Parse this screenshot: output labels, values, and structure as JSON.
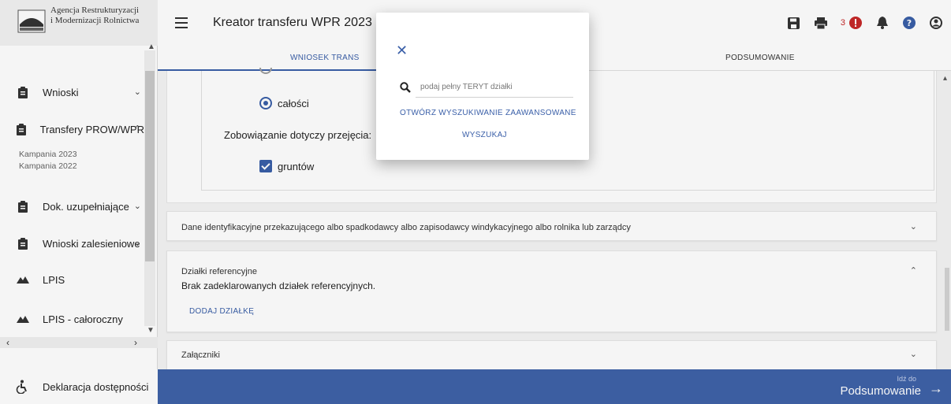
{
  "brand": {
    "line1": "Agencja Restrukturyzacji",
    "line2": "i Modernizacji Rolnictwa"
  },
  "sidebar": {
    "items": [
      {
        "label": "Wnioski",
        "icon": "clipboard-icon"
      },
      {
        "label": "Transfery PROW/WPR",
        "icon": "clipboard-icon"
      },
      {
        "label": "Dok. uzupełniające",
        "icon": "clipboard-icon"
      },
      {
        "label": "Wnioski zalesieniowe",
        "icon": "clipboard-icon"
      },
      {
        "label": "LPIS",
        "icon": "mountain-icon"
      },
      {
        "label": "LPIS - całoroczny",
        "icon": "mountain-icon"
      }
    ],
    "sub_items": [
      "Kampania 2023",
      "Kampania 2022"
    ],
    "bottom_item": "Deklaracja dostępności"
  },
  "header": {
    "title": "Kreator transferu WPR 2023 - W",
    "notification_count": "3"
  },
  "tabs": [
    "WNIOSEK TRANS",
    "PODSUMOWANIE"
  ],
  "form": {
    "radio_label": "całości",
    "commitment_label": "Zobowiązanie dotyczy przejęcia:",
    "checkbox_label": "gruntów"
  },
  "panels": {
    "identity_title": "Dane identyfikacyjne przekazującego albo spadkodawcy albo zapisodawcy windykacyjnego albo rolnika lub zarządcy",
    "parcels_title": "Działki referencyjne",
    "parcels_empty": "Brak zadeklarowanych działek referencyjnych.",
    "add_parcel": "DODAJ DZIAŁKĘ",
    "attachments_title": "Załączniki"
  },
  "footer": {
    "goto_small": "Idź do",
    "goto_big": "Podsumowanie"
  },
  "modal": {
    "search_placeholder": "podaj pełny TERYT działki",
    "advanced_search": "OTWÓRZ WYSZUKIWANIE ZAAWANSOWANE",
    "search_button": "WYSZUKAJ"
  },
  "colors": {
    "accent": "#3a5fa8",
    "footer": "#3f62a8",
    "notification": "#c62828"
  }
}
